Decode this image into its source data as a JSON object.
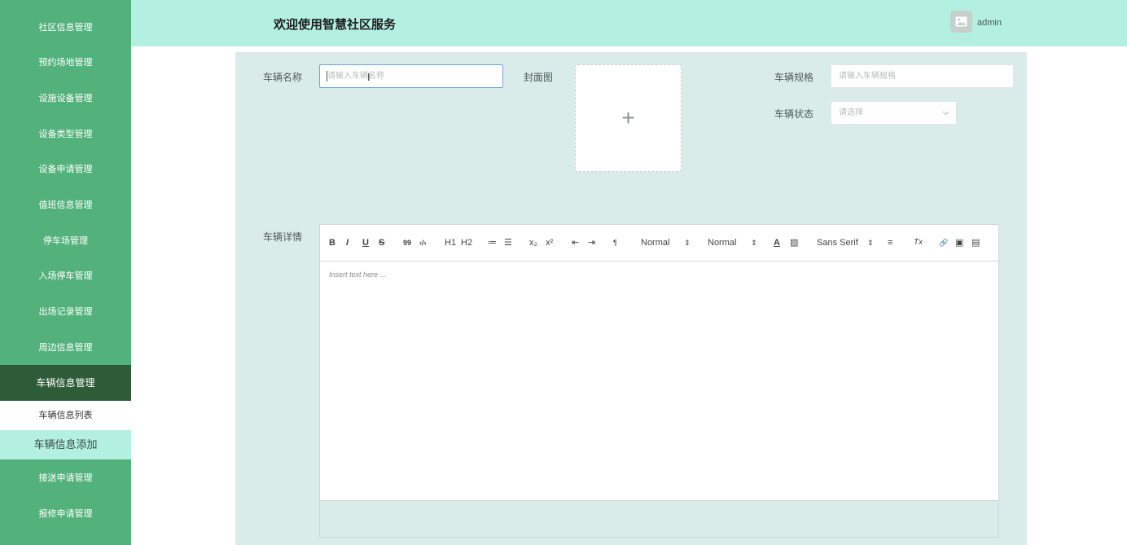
{
  "sidebar": {
    "items": [
      {
        "label": "社区信息管理"
      },
      {
        "label": "预约场地管理"
      },
      {
        "label": "设施设备管理"
      },
      {
        "label": "设备类型管理"
      },
      {
        "label": "设备申请管理"
      },
      {
        "label": "值班信息管理"
      },
      {
        "label": "停车场管理"
      },
      {
        "label": "入场停车管理"
      },
      {
        "label": "出场记录管理"
      },
      {
        "label": "周边信息管理"
      },
      {
        "label": "车辆信息管理"
      },
      {
        "label": "接送申请管理"
      },
      {
        "label": "报修申请管理"
      }
    ],
    "active_index": 10,
    "sub_items": [
      {
        "label": "车辆信息列表"
      },
      {
        "label": "车辆信息添加"
      }
    ]
  },
  "header": {
    "title": "欢迎使用智慧社区服务",
    "user": "admin"
  },
  "form": {
    "name_label": "车辆名称",
    "name_placeholder": "请输入车辆名称",
    "cover_label": "封面图",
    "cover_upload_symbol": "+",
    "spec_label": "车辆规格",
    "spec_placeholder": "请输入车辆规格",
    "status_label": "车辆状态",
    "status_placeholder": "请选择",
    "detail_label": "车辆详情"
  },
  "editor": {
    "placeholder": "Insert text here ...",
    "header_select": "Normal",
    "size_select": "Normal",
    "font_select": "Sans Serif",
    "toolbar_glyphs": {
      "bold": "B",
      "italic": "I",
      "underline": "U",
      "strike": "S",
      "blockquote": "99",
      "code": "‹/›",
      "h1": "H1",
      "h2": "H2",
      "ordered_list": "≔",
      "bullet_list": "☰",
      "subscript": "x₂",
      "superscript": "x²",
      "outdent": "⇤",
      "indent": "⇥",
      "direction": "¶",
      "font_color": "A",
      "background": "▨",
      "align": "≡",
      "clean": "Tx",
      "link": "🔗",
      "image": "▣",
      "video": "▤",
      "select_arrow": "⇕"
    }
  }
}
